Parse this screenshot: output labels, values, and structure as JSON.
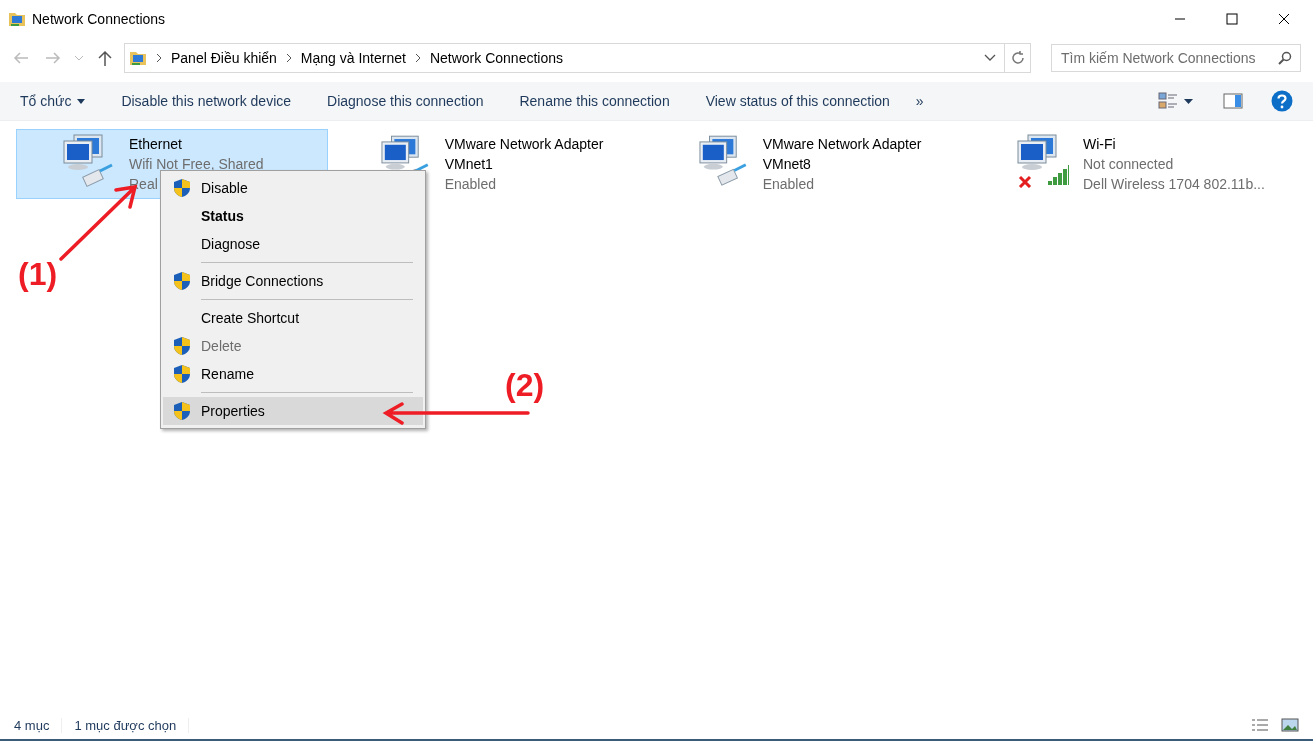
{
  "window": {
    "title": "Network Connections"
  },
  "address": {
    "crumbs": [
      "Panel Điều khiển",
      "Mạng và Internet",
      "Network Connections"
    ]
  },
  "search": {
    "placeholder": "Tìm kiếm Network Connections"
  },
  "toolbar": {
    "items": [
      {
        "label": "Tổ chức",
        "kind": "dropdown"
      },
      {
        "label": "Disable this network device",
        "kind": "command"
      },
      {
        "label": "Diagnose this connection",
        "kind": "command"
      },
      {
        "label": "Rename this connection",
        "kind": "command"
      },
      {
        "label": "View status of this connection",
        "kind": "command"
      },
      {
        "label": "»",
        "kind": "more"
      }
    ]
  },
  "connections": [
    {
      "name": "Ethernet",
      "lines": [
        "Wifi Not Free, Shared",
        "Real"
      ],
      "kind": "wired",
      "selected": true
    },
    {
      "name": "VMware Network Adapter VMnet1",
      "lines": [
        "Enabled"
      ],
      "kind": "wired",
      "selected": false
    },
    {
      "name": "VMware Network Adapter VMnet8",
      "lines": [
        "Enabled"
      ],
      "kind": "wired",
      "selected": false
    },
    {
      "name": "Wi-Fi",
      "lines": [
        "Not connected",
        "Dell Wireless 1704 802.11b..."
      ],
      "kind": "wireless",
      "selected": false
    }
  ],
  "context_menu": {
    "items": [
      {
        "label": "Disable",
        "kind": "item",
        "shield": true,
        "bold": false,
        "disabled": false,
        "selected": false
      },
      {
        "label": "Status",
        "kind": "item",
        "shield": false,
        "bold": true,
        "disabled": false,
        "selected": false
      },
      {
        "label": "Diagnose",
        "kind": "item",
        "shield": false,
        "bold": false,
        "disabled": false,
        "selected": false
      },
      {
        "kind": "separator"
      },
      {
        "label": "Bridge Connections",
        "kind": "item",
        "shield": true,
        "bold": false,
        "disabled": false,
        "selected": false
      },
      {
        "kind": "separator"
      },
      {
        "label": "Create Shortcut",
        "kind": "item",
        "shield": false,
        "bold": false,
        "disabled": false,
        "selected": false
      },
      {
        "label": "Delete",
        "kind": "item",
        "shield": true,
        "bold": false,
        "disabled": true,
        "selected": false
      },
      {
        "label": "Rename",
        "kind": "item",
        "shield": true,
        "bold": false,
        "disabled": false,
        "selected": false
      },
      {
        "kind": "separator"
      },
      {
        "label": "Properties",
        "kind": "item",
        "shield": true,
        "bold": false,
        "disabled": false,
        "selected": true
      }
    ]
  },
  "annotations": [
    {
      "label": "(1)"
    },
    {
      "label": "(2)"
    }
  ],
  "status_bar": {
    "count": "4 mục",
    "selection": "1 mục được chọn"
  }
}
